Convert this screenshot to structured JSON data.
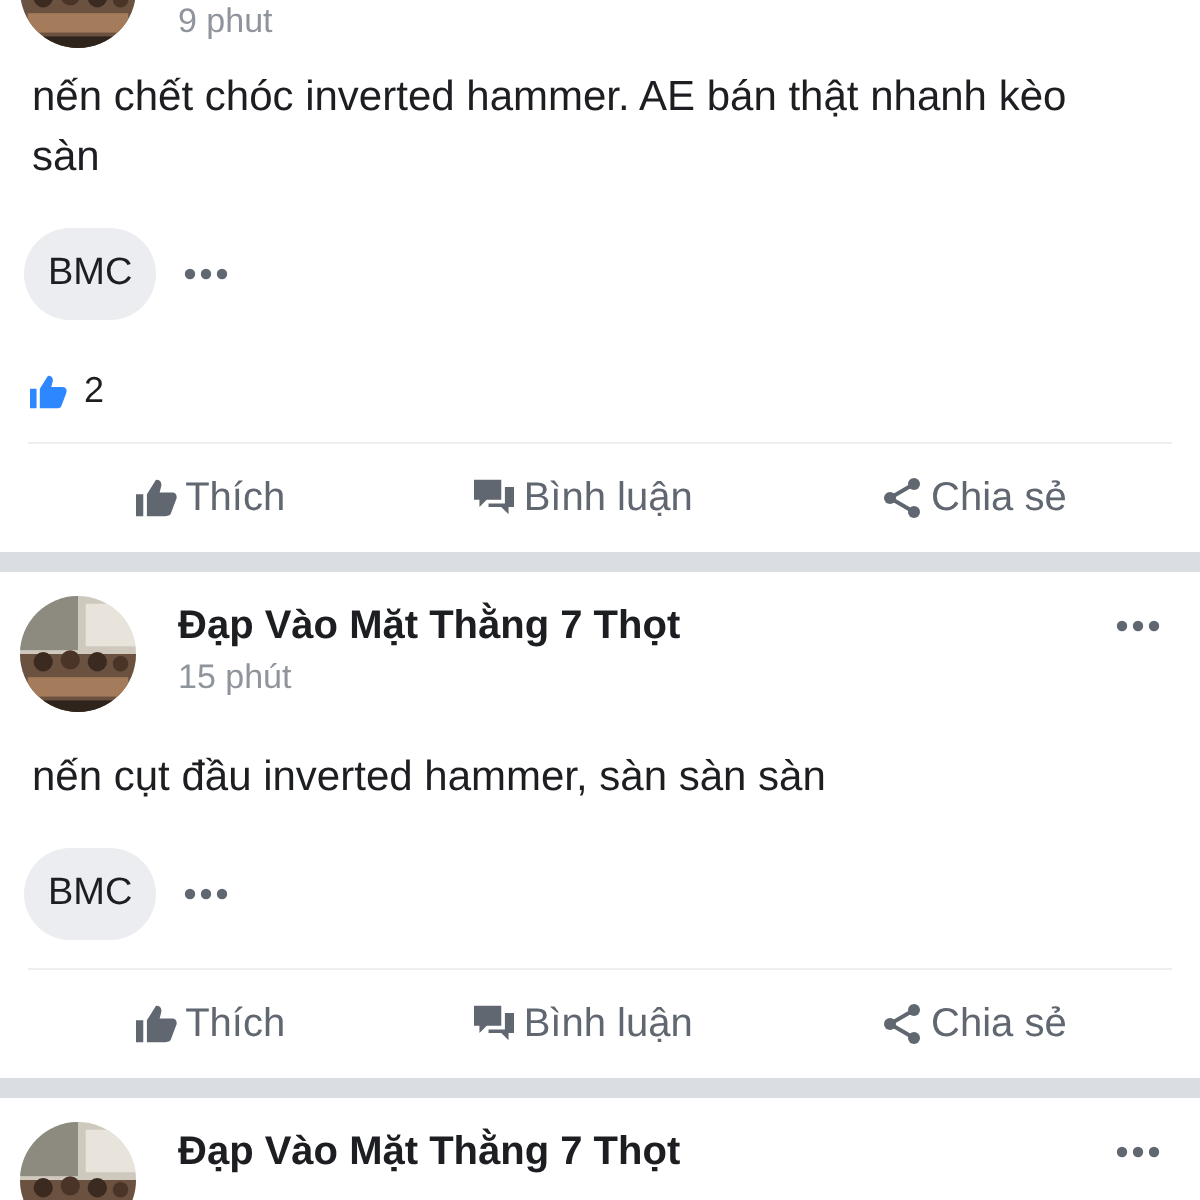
{
  "posts": [
    {
      "time": "9 phut",
      "text": "nến chết chóc inverted hammer. AE bán thật nhanh kèo sàn",
      "tags": [
        "BMC"
      ],
      "reactions": "2",
      "actions": [
        {
          "kind": "like",
          "label": "Thích"
        },
        {
          "kind": "comment",
          "label": "Bình luận"
        },
        {
          "kind": "share",
          "label": "Chia sẻ"
        }
      ]
    },
    {
      "author": "Đạp Vào Mặt Thằng 7 Thọt",
      "time": "15 phút",
      "text": "nến cụt đầu inverted hammer, sàn sàn sàn",
      "tags": [
        "BMC"
      ],
      "actions": [
        {
          "kind": "like",
          "label": "Thích"
        },
        {
          "kind": "comment",
          "label": "Bình luận"
        },
        {
          "kind": "share",
          "label": "Chia sẻ"
        }
      ]
    },
    {
      "author": "Đạp Vào Mặt Thằng 7 Thọt"
    }
  ]
}
